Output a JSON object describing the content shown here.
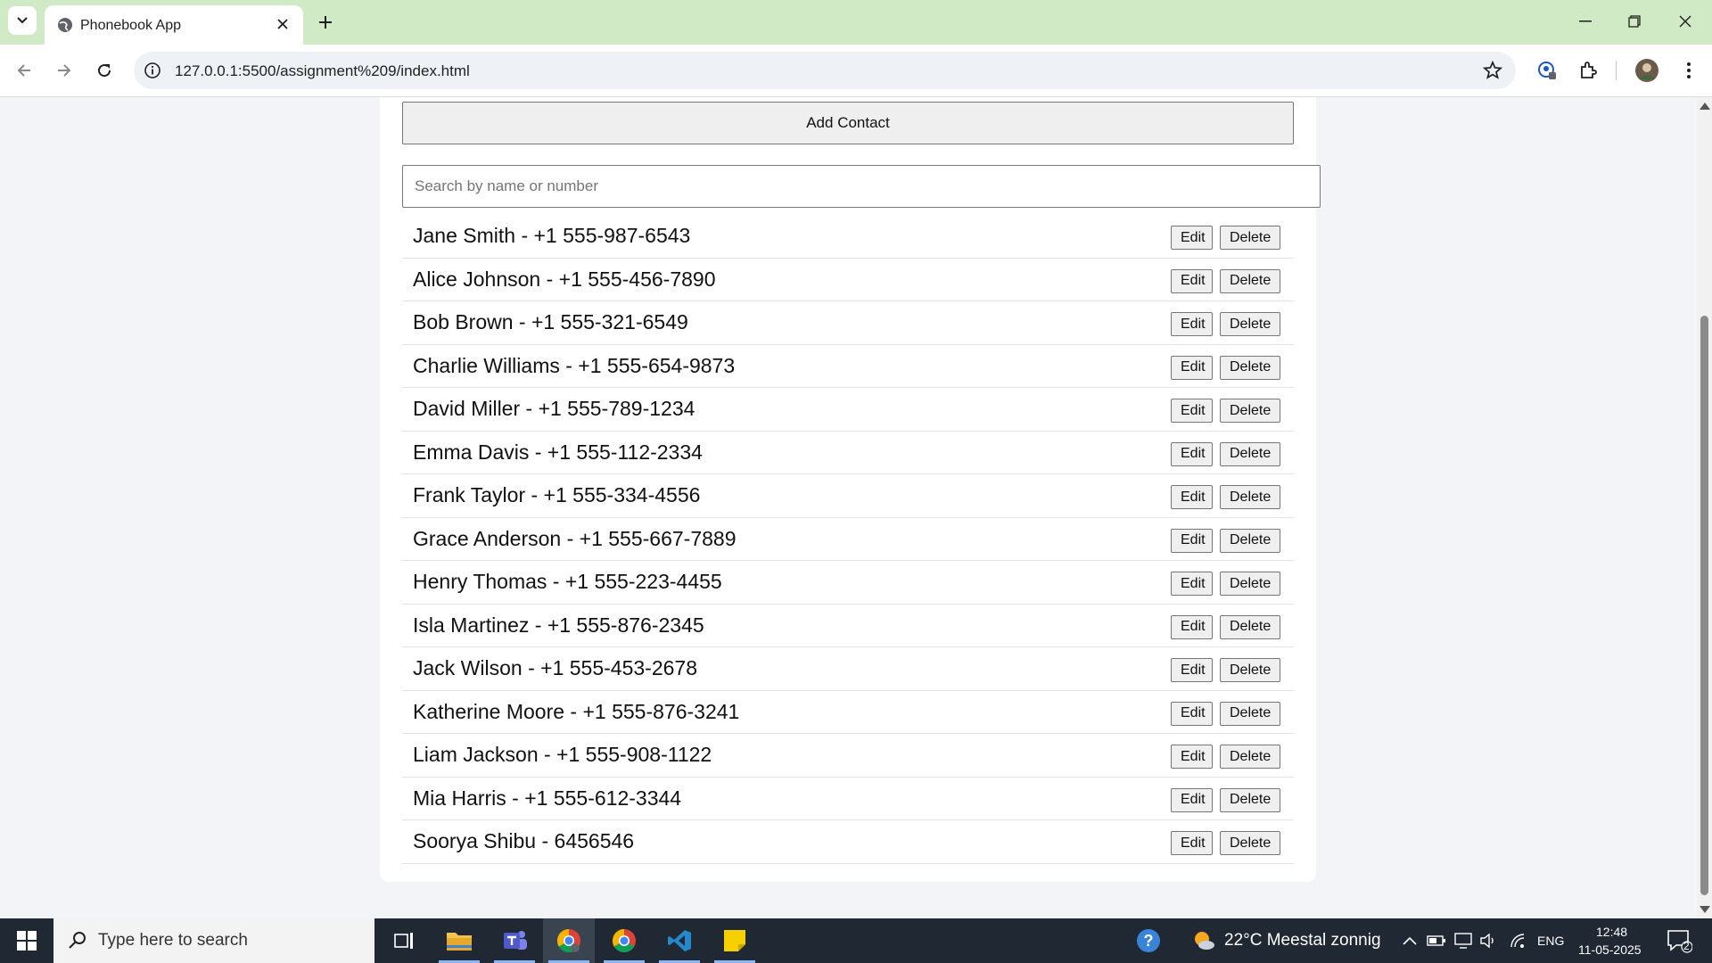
{
  "browser": {
    "tab_title": "Phonebook App",
    "url": "127.0.0.1:5500/assignment%209/index.html"
  },
  "page": {
    "add_button": "Add Contact",
    "search_placeholder": "Search by name or number",
    "contacts": [
      {
        "text": "Jane Smith - +1 555-987-6543"
      },
      {
        "text": "Alice Johnson - +1 555-456-7890"
      },
      {
        "text": "Bob Brown - +1 555-321-6549"
      },
      {
        "text": "Charlie Williams - +1 555-654-9873"
      },
      {
        "text": "David Miller - +1 555-789-1234"
      },
      {
        "text": "Emma Davis - +1 555-112-2334"
      },
      {
        "text": "Frank Taylor - +1 555-334-4556"
      },
      {
        "text": "Grace Anderson - +1 555-667-7889"
      },
      {
        "text": "Henry Thomas - +1 555-223-4455"
      },
      {
        "text": "Isla Martinez - +1 555-876-2345"
      },
      {
        "text": "Jack Wilson - +1 555-453-2678"
      },
      {
        "text": "Katherine Moore - +1 555-876-3241"
      },
      {
        "text": "Liam Jackson - +1 555-908-1122"
      },
      {
        "text": "Mia Harris - +1 555-612-3344"
      },
      {
        "text": "Soorya Shibu - 6456546"
      }
    ],
    "edit_label": "Edit",
    "delete_label": "Delete"
  },
  "taskbar": {
    "search_placeholder": "Type here to search",
    "weather": "22°C  Meestal zonnig",
    "language": "ENG",
    "time": "12:48",
    "date": "11-05-2025",
    "notification_count": "2"
  },
  "colors": {
    "tabbar_bg": "#cfeac4",
    "page_bg": "#f2f4f7",
    "taskbar_bg": "#202833"
  }
}
